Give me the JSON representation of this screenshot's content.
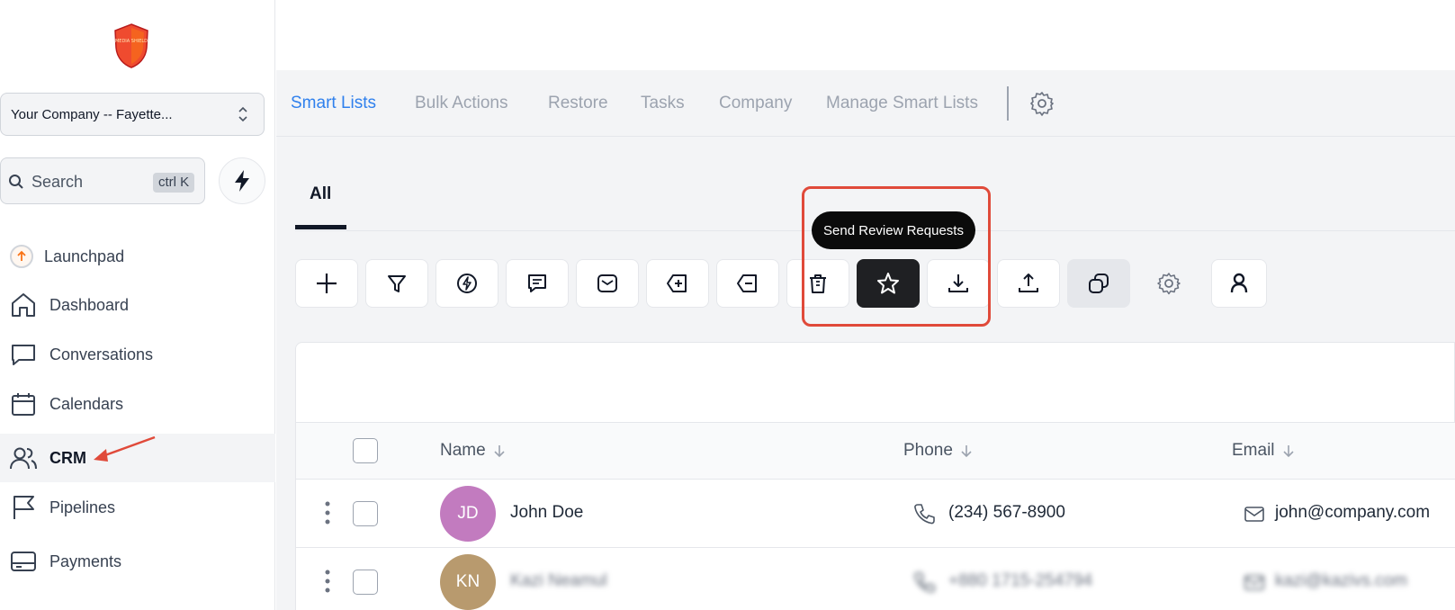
{
  "sidebar": {
    "logo_text": "MEDIA SHIELD",
    "company_select": "Your Company -- Fayette...",
    "search": {
      "label": "Search",
      "shortcut": "ctrl K"
    },
    "nav": [
      {
        "label": "Launchpad",
        "icon": "launchpad-icon"
      },
      {
        "label": "Dashboard",
        "icon": "home-icon"
      },
      {
        "label": "Conversations",
        "icon": "chat-icon"
      },
      {
        "label": "Calendars",
        "icon": "calendar-icon"
      },
      {
        "label": "CRM",
        "icon": "users-icon",
        "active": true
      },
      {
        "label": "Pipelines",
        "icon": "flag-icon"
      },
      {
        "label": "Payments",
        "icon": "payments-icon"
      }
    ]
  },
  "tabs": [
    {
      "label": "Smart Lists",
      "active": true
    },
    {
      "label": "Bulk Actions"
    },
    {
      "label": "Restore"
    },
    {
      "label": "Tasks"
    },
    {
      "label": "Company"
    },
    {
      "label": "Manage Smart Lists"
    }
  ],
  "subtab": "All",
  "toolbar": {
    "tooltip": "Send Review Requests",
    "buttons": [
      "add-icon",
      "filter-icon",
      "workflow-icon",
      "sms-icon",
      "email-icon",
      "add-tag-icon",
      "remove-tag-icon",
      "delete-icon",
      "star-icon",
      "download-icon",
      "upload-icon",
      "duplicate-icon",
      "settings-icon",
      "user-icon"
    ]
  },
  "table": {
    "columns": {
      "name": "Name",
      "phone": "Phone",
      "email": "Email"
    },
    "rows": [
      {
        "initials": "JD",
        "name": "John Doe",
        "phone": "(234) 567-8900",
        "email": "john@company.com",
        "avatar_color": "#c27bbf"
      },
      {
        "initials": "KN",
        "name": "Kazi Neamul",
        "phone": "+880 1715-254794",
        "email": "kazi@kazivs.com",
        "avatar_color": "#b89a6e"
      }
    ]
  },
  "colors": {
    "accent": "#2f80ed",
    "highlight": "#e04a3a"
  }
}
